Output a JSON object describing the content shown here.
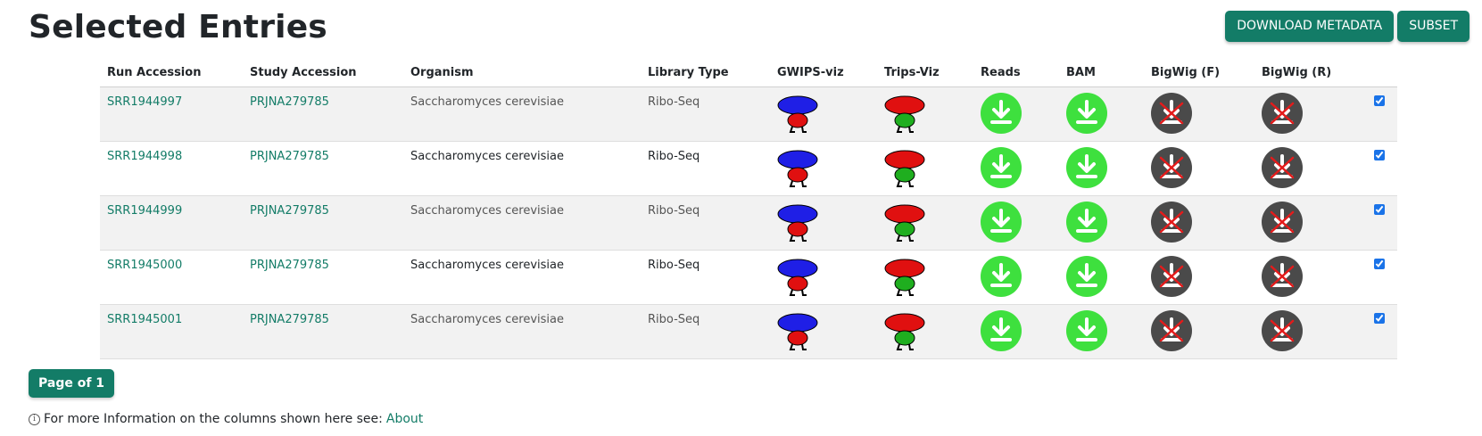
{
  "page": {
    "title": "Selected Entries"
  },
  "toolbar": {
    "download_label": "DOWNLOAD METADATA",
    "subset_label": "SUBSET"
  },
  "table": {
    "headers": [
      "Run Accession",
      "Study Accession",
      "Organism",
      "Library Type",
      "GWIPS-viz",
      "Trips-Viz",
      "Reads",
      "BAM",
      "BigWig (F)",
      "BigWig (R)",
      ""
    ],
    "rows": [
      {
        "run": "SRR1944997",
        "study": "PRJNA279785",
        "organism": "Saccharomyces cerevisiae",
        "library": "Ribo-Seq",
        "selected": true
      },
      {
        "run": "SRR1944998",
        "study": "PRJNA279785",
        "organism": "Saccharomyces cerevisiae",
        "library": "Ribo-Seq",
        "selected": true
      },
      {
        "run": "SRR1944999",
        "study": "PRJNA279785",
        "organism": "Saccharomyces cerevisiae",
        "library": "Ribo-Seq",
        "selected": true
      },
      {
        "run": "SRR1945000",
        "study": "PRJNA279785",
        "organism": "Saccharomyces cerevisiae",
        "library": "Ribo-Seq",
        "selected": true
      },
      {
        "run": "SRR1945001",
        "study": "PRJNA279785",
        "organism": "Saccharomyces cerevisiae",
        "library": "Ribo-Seq",
        "selected": true
      }
    ],
    "icons": {
      "gwips": "gwips-viz-icon",
      "trips": "trips-viz-icon",
      "reads": "download-reads-icon",
      "bam": "download-bam-icon",
      "bigwig_f": "bigwig-unavailable-icon",
      "bigwig_r": "bigwig-unavailable-icon"
    }
  },
  "pagination": {
    "label": "Page of 1"
  },
  "footer": {
    "text": "For more Information on the columns shown here see:",
    "link": "About",
    "info_glyph": "i"
  },
  "colors": {
    "accent": "#137c67",
    "download_green": "#3ee03e",
    "unavailable_gray": "#4a4a4a",
    "row_stripe": "#f2f2f2"
  }
}
